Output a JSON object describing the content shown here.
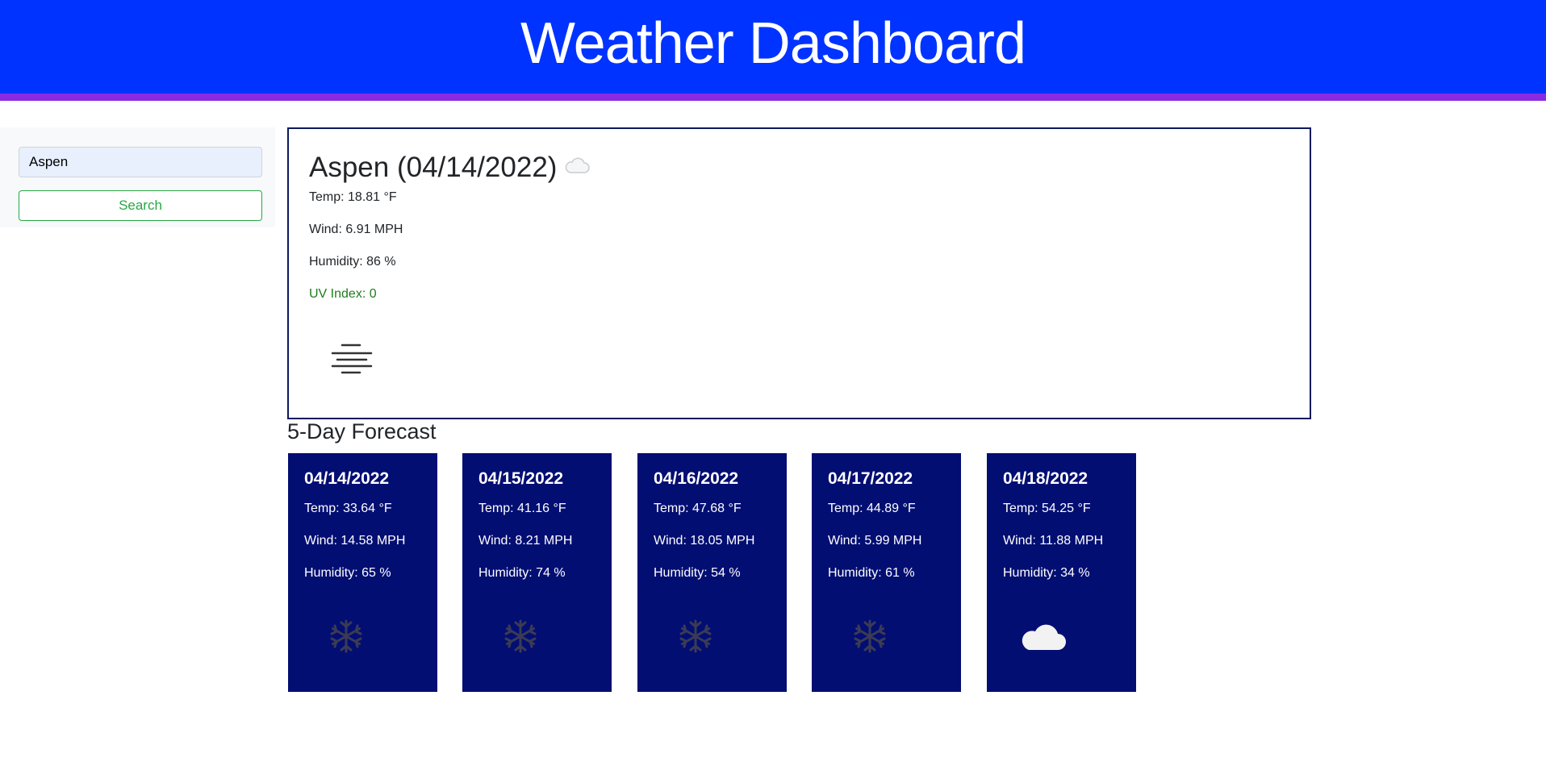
{
  "header": {
    "title": "Weather Dashboard"
  },
  "search": {
    "value": "Aspen",
    "button_label": "Search"
  },
  "current": {
    "title": "Aspen (04/14/2022)",
    "temp": "Temp: 18.81 °F",
    "wind": "Wind: 6.91 MPH",
    "humidity": "Humidity: 86 %",
    "uv": "UV Index: 0",
    "title_icon": "cloud-icon",
    "condition_icon": "mist-icon"
  },
  "forecast": {
    "title": "5-Day Forecast",
    "days": [
      {
        "date": "04/14/2022",
        "temp": "Temp: 33.64 °F",
        "wind": "Wind: 14.58 MPH",
        "humidity": "Humidity: 65 %",
        "icon": "snow-icon"
      },
      {
        "date": "04/15/2022",
        "temp": "Temp: 41.16 °F",
        "wind": "Wind: 8.21 MPH",
        "humidity": "Humidity: 74 %",
        "icon": "snow-icon"
      },
      {
        "date": "04/16/2022",
        "temp": "Temp: 47.68 °F",
        "wind": "Wind: 18.05 MPH",
        "humidity": "Humidity: 54 %",
        "icon": "snow-icon"
      },
      {
        "date": "04/17/2022",
        "temp": "Temp: 44.89 °F",
        "wind": "Wind: 5.99 MPH",
        "humidity": "Humidity: 61 %",
        "icon": "snow-icon"
      },
      {
        "date": "04/18/2022",
        "temp": "Temp: 54.25 °F",
        "wind": "Wind: 11.88 MPH",
        "humidity": "Humidity: 34 %",
        "icon": "cloud-icon"
      }
    ]
  },
  "colors": {
    "header_bg": "#0033ff",
    "accent_bar": "#8a2be2",
    "card_bg": "#030e72",
    "uv_low": "#1e7d1e",
    "search_button": "#28a745"
  }
}
